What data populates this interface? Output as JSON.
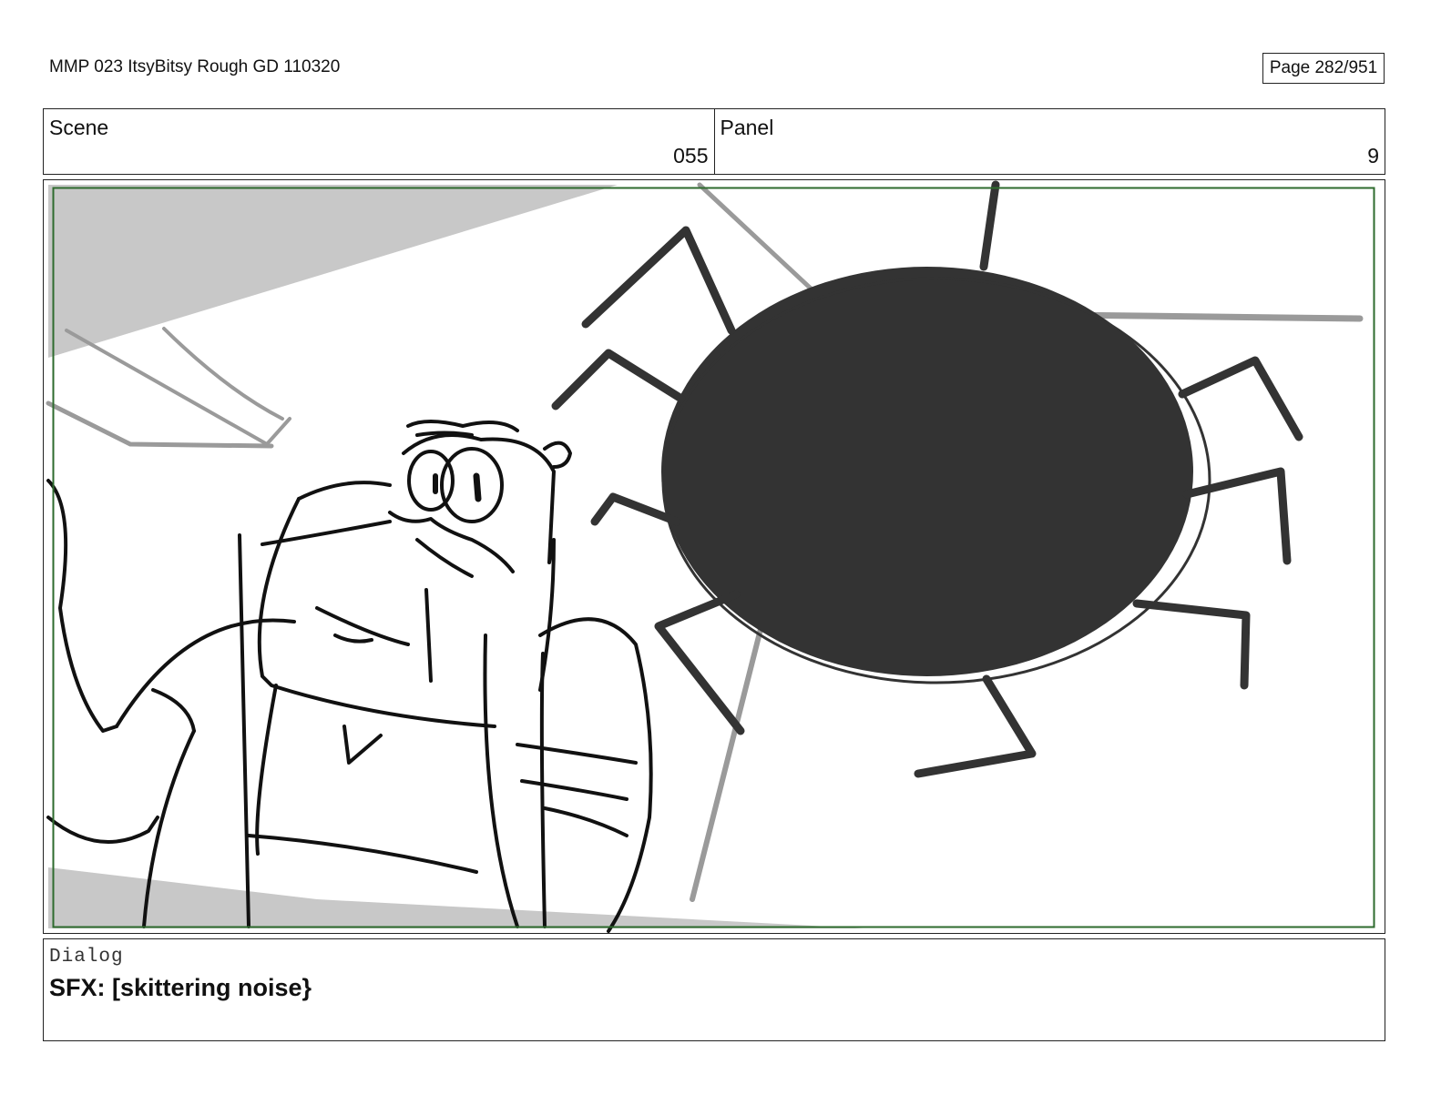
{
  "document": {
    "title": "MMP 023 ItsyBitsy Rough GD 110320",
    "page": "Page 282/951"
  },
  "header": {
    "scene_label": "Scene",
    "scene_value": "055",
    "panel_label": "Panel",
    "panel_value": "9"
  },
  "dialog": {
    "label": "Dialog",
    "text": "SFX: [skittering noise}"
  },
  "colors": {
    "frame_border": "#2e6b2e",
    "spider_fill": "#333333",
    "shadow_gray": "#c8c8c8",
    "guide_gray": "#9a9a9a"
  }
}
